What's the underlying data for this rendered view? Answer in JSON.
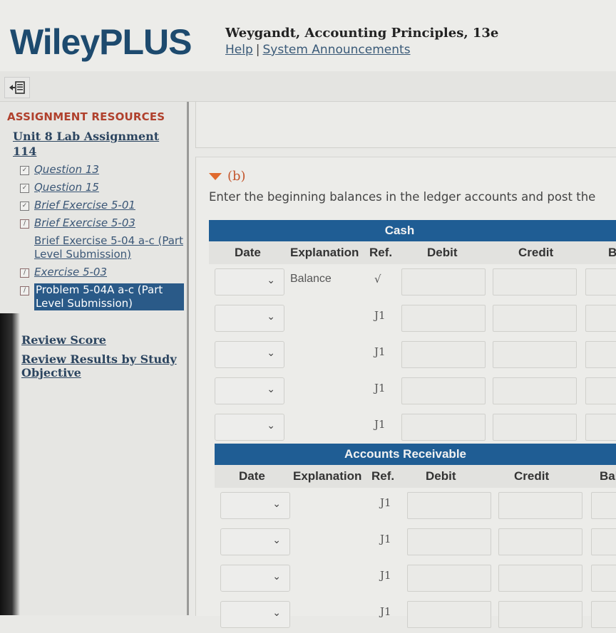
{
  "header": {
    "logo": "WileyPLUS",
    "course_title": "Weygandt, Accounting Principles, 13e",
    "links": [
      "Help",
      "System Announcements"
    ],
    "separator": "|"
  },
  "toolbar": {
    "collapse_icon": "collapse-sidebar-icon"
  },
  "sidebar": {
    "heading": "ASSIGNMENT RESOURCES",
    "assignment_link": "Unit 8 Lab Assignment 114",
    "items": [
      {
        "label": "Question 13",
        "checked": true,
        "status_icon": "check"
      },
      {
        "label": "Question 15",
        "checked": true,
        "status_icon": "check"
      },
      {
        "label": "Brief Exercise 5-01",
        "checked": true,
        "status_icon": "check"
      },
      {
        "label": "Brief Exercise 5-03",
        "checked": true,
        "status_icon": "pencil"
      },
      {
        "label": "Brief Exercise 5-04 a-c (Part Level Submission)",
        "checked": false,
        "status_icon": "none"
      },
      {
        "label": "Exercise 5-03",
        "checked": true,
        "status_icon": "pencil"
      },
      {
        "label": "Problem 5-04A a-c (Part Level Submission)",
        "checked": true,
        "status_icon": "pencil",
        "selected": true
      }
    ],
    "review_score": "Review Score",
    "review_results": "Review Results by Study Objective"
  },
  "content": {
    "part_label": "(b)",
    "instructions": "Enter the beginning balances in the ledger accounts and post the",
    "ledgers": [
      {
        "title": "Cash",
        "columns": [
          "Date",
          "Explanation",
          "Ref.",
          "Debit",
          "Credit",
          "B"
        ],
        "rows": [
          {
            "date": "",
            "explanation": "Balance",
            "ref": "√",
            "debit": "",
            "credit": "",
            "balance": ""
          },
          {
            "date": "",
            "explanation": "",
            "ref": "J1",
            "debit": "",
            "credit": "",
            "balance": ""
          },
          {
            "date": "",
            "explanation": "",
            "ref": "J1",
            "debit": "",
            "credit": "",
            "balance": ""
          },
          {
            "date": "",
            "explanation": "",
            "ref": "J1",
            "debit": "",
            "credit": "",
            "balance": ""
          },
          {
            "date": "",
            "explanation": "",
            "ref": "J1",
            "debit": "",
            "credit": "",
            "balance": ""
          }
        ]
      },
      {
        "title": "Accounts Receivable",
        "columns": [
          "Date",
          "Explanation",
          "Ref.",
          "Debit",
          "Credit",
          "Bal"
        ],
        "rows": [
          {
            "date": "",
            "explanation": "",
            "ref": "J1",
            "debit": "",
            "credit": "",
            "balance": ""
          },
          {
            "date": "",
            "explanation": "",
            "ref": "J1",
            "debit": "",
            "credit": "",
            "balance": ""
          },
          {
            "date": "",
            "explanation": "",
            "ref": "J1",
            "debit": "",
            "credit": "",
            "balance": ""
          },
          {
            "date": "",
            "explanation": "",
            "ref": "J1",
            "debit": "",
            "credit": "",
            "balance": ""
          }
        ]
      }
    ]
  }
}
